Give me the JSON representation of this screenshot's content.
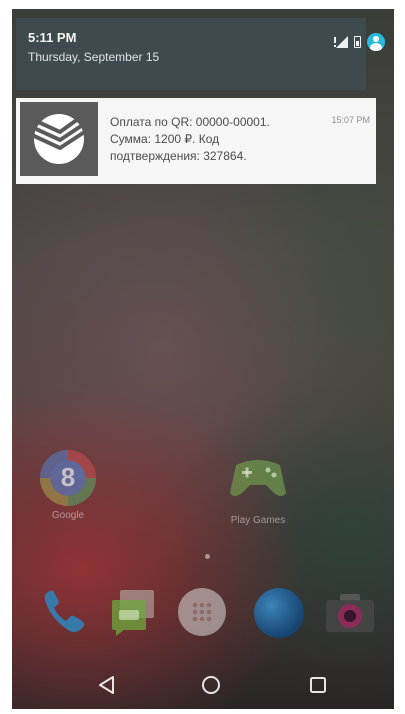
{
  "status_bar": {
    "time": "5:11 PM",
    "date": "Thursday, September 15",
    "icons": [
      "signal-no-data-icon",
      "battery-icon",
      "user-account-icon"
    ]
  },
  "notification": {
    "app_icon": "sberbank-logo",
    "line1": "Оплата по QR: 00000-00001.",
    "line2": "Сумма: 1200 ₽. Код",
    "line3": "подтверждения: 327864.",
    "time": "15:07 PM"
  },
  "home_apps": [
    {
      "label": "Google",
      "icon": "google-folder-icon"
    },
    {
      "label": "Play Games",
      "icon": "play-games-icon"
    }
  ],
  "dock": [
    {
      "icon": "phone-icon"
    },
    {
      "icon": "messenger-icon"
    },
    {
      "icon": "app-drawer-icon"
    },
    {
      "icon": "browser-globe-icon"
    },
    {
      "icon": "camera-icon"
    }
  ],
  "navigation": [
    "back-icon",
    "home-icon",
    "recents-icon"
  ],
  "colors": {
    "notification_bg": "#f6f6f6",
    "shade_bg": "#3f4a4f",
    "accent_avatar": "#28b9dc",
    "sber_icon_bg": "#5a5a5a"
  }
}
